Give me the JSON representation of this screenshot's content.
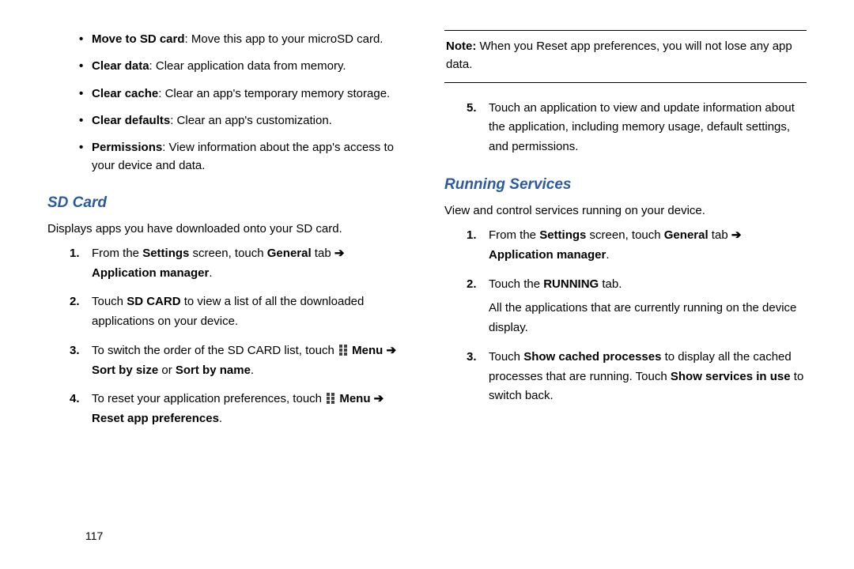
{
  "leftCol": {
    "bullets": [
      {
        "bold": "Move to SD card",
        "rest": ": Move this app to your microSD card."
      },
      {
        "bold": "Clear data",
        "rest": ": Clear application data from memory."
      },
      {
        "bold": "Clear cache",
        "rest": ": Clear an app's temporary memory storage."
      },
      {
        "bold": "Clear defaults",
        "rest": ": Clear an app's customization."
      },
      {
        "bold": "Permissions",
        "rest": ": View information about the app's access to your device and data."
      }
    ],
    "heading": "SD Card",
    "intro": "Displays apps you have downloaded onto your SD card.",
    "steps": {
      "s1": {
        "num": "1.",
        "t1": "From the ",
        "b1": "Settings",
        "t2": " screen, touch ",
        "b2": "General",
        "t3": " tab ",
        "arrow": "➔",
        "b3": " Application manager",
        "t4": "."
      },
      "s2": {
        "num": "2.",
        "t1": "Touch ",
        "b1": "SD CARD",
        "t2": " to view a list of all the downloaded applications on your device."
      },
      "s3": {
        "num": "3.",
        "t1": "To switch the order of the SD CARD list, touch ",
        "menu": true,
        "b1": " Menu",
        "arrow": " ➔ ",
        "b2": "Sort by size",
        "t2": " or ",
        "b3": "Sort by name",
        "t3": "."
      },
      "s4": {
        "num": "4.",
        "t1": "To reset your application preferences, touch ",
        "menu": true,
        "b1": " Menu",
        "arrow": " ➔ ",
        "b2": "Reset app preferences",
        "t2": "."
      }
    }
  },
  "rightCol": {
    "note": {
      "bold": "Note:",
      "rest": " When you Reset app preferences, you will not lose any app data."
    },
    "step5": {
      "num": "5.",
      "text": "Touch an application to view and update information about the application, including memory usage, default settings, and permissions."
    },
    "heading": "Running Services",
    "intro": "View and control services running on your device.",
    "steps": {
      "s1": {
        "num": "1.",
        "t1": "From the ",
        "b1": "Settings",
        "t2": " screen, touch ",
        "b2": "General",
        "t3": " tab ",
        "arrow": "➔",
        "b3": " Application manager",
        "t4": "."
      },
      "s2": {
        "num": "2.",
        "t1": "Touch the ",
        "b1": "RUNNING",
        "t2": " tab.",
        "t3": "All the applications that are currently running on the device display."
      },
      "s3": {
        "num": "3.",
        "t1": "Touch ",
        "b1": "Show cached processes",
        "t2": " to display all the cached processes that are running. Touch ",
        "b2": "Show services in use",
        "t3": " to switch back."
      }
    }
  },
  "pageNumber": "117"
}
